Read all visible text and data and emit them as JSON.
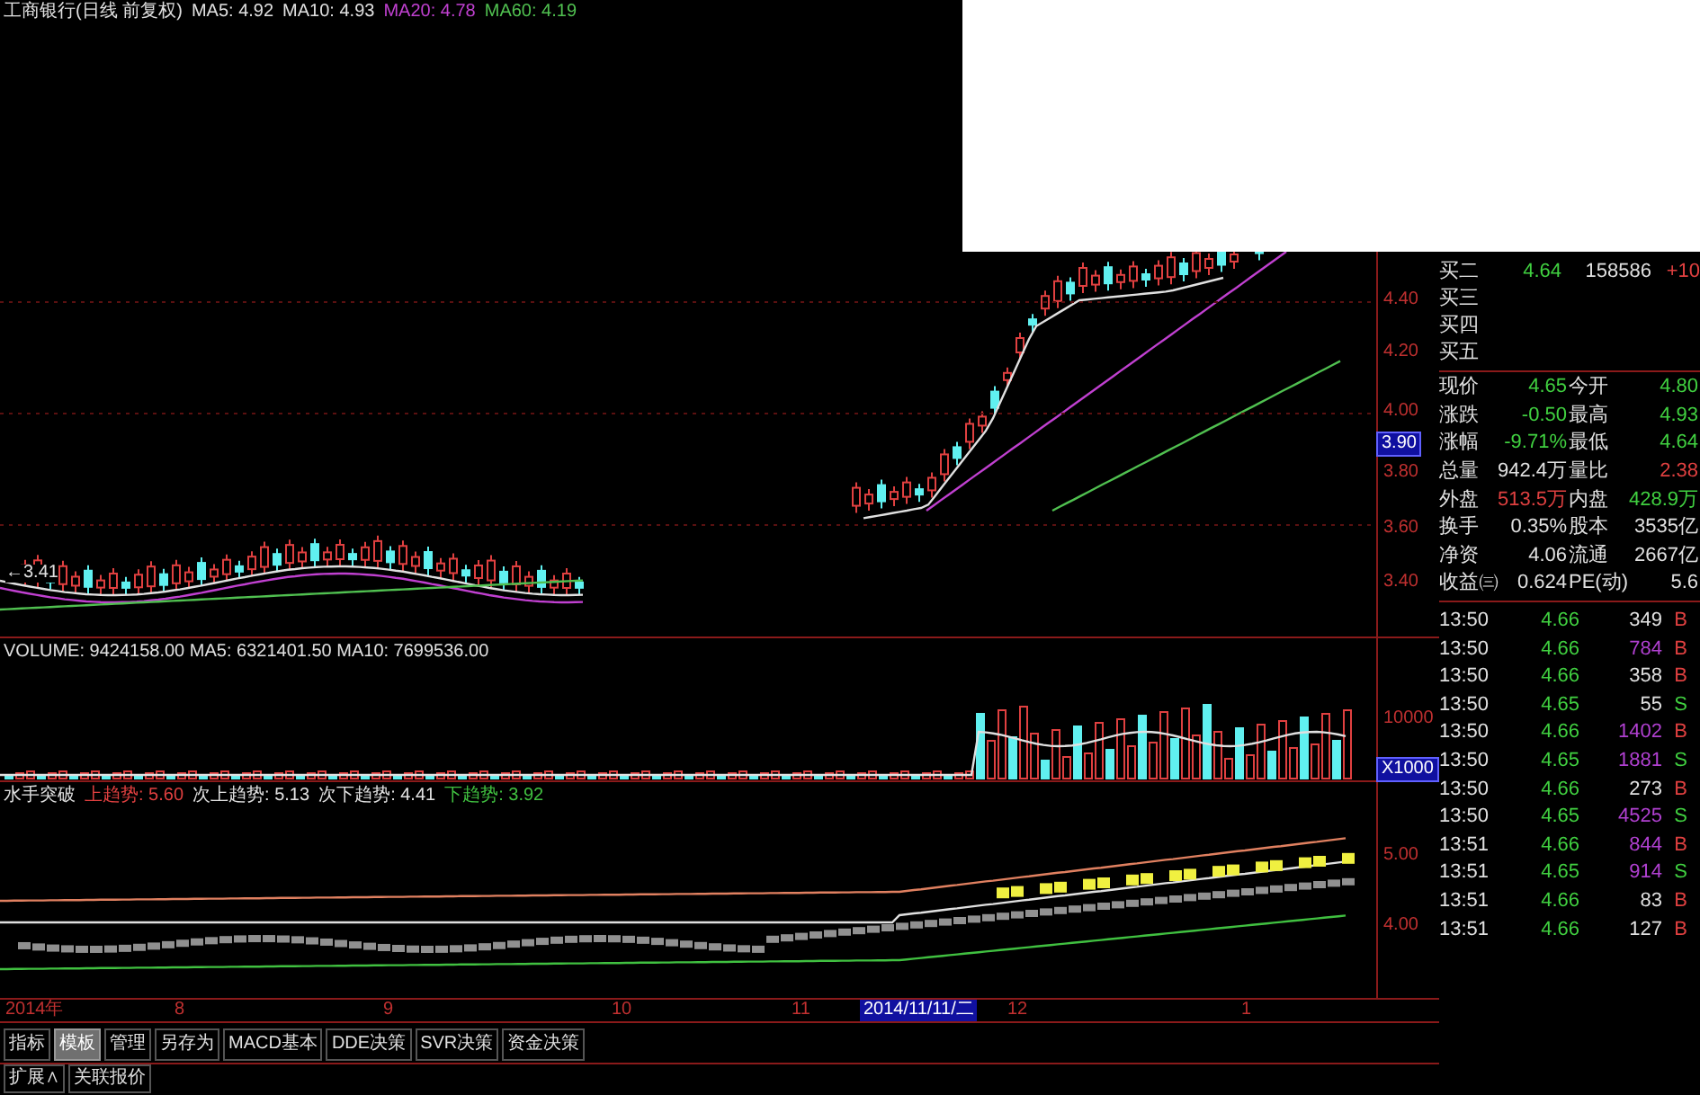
{
  "header": {
    "title": "工商银行(日线 前复权)",
    "averages": [
      {
        "label": "MA5: 4.92",
        "color": "#e0e0e0"
      },
      {
        "label": "MA10: 4.93",
        "color": "#e0e0e0"
      },
      {
        "label": "MA20: 4.78",
        "color": "#c040d0"
      },
      {
        "label": "MA60: 4.19",
        "color": "#50c050"
      }
    ]
  },
  "price_panel": {
    "low_marker": "←3.41",
    "axis": [
      {
        "label": "4.40",
        "kind": "tick"
      },
      {
        "label": "4.20",
        "kind": "tick"
      },
      {
        "label": "4.00",
        "kind": "tick"
      },
      {
        "label": "3.90",
        "kind": "cursor"
      },
      {
        "label": "3.80",
        "kind": "tick"
      },
      {
        "label": "3.60",
        "kind": "tick"
      },
      {
        "label": "3.40",
        "kind": "tick"
      }
    ]
  },
  "volume_panel": {
    "header": "VOLUME: 9424158.00 MA5: 6321401.50 MA10: 7699536.00",
    "axis": [
      {
        "label": "10000",
        "kind": "tick"
      },
      {
        "label": "X1000",
        "kind": "cursor"
      }
    ]
  },
  "indicator_panel": {
    "name": "水手突破",
    "lines": [
      {
        "label": "上趋势: 5.60",
        "color": "#e04040"
      },
      {
        "label": "次上趋势: 5.13",
        "color": "#e0e0e0"
      },
      {
        "label": "次下趋势: 4.41",
        "color": "#e0e0e0"
      },
      {
        "label": "下趋势: 3.92",
        "color": "#40c040"
      }
    ],
    "axis": [
      {
        "label": "5.00",
        "kind": "tick"
      },
      {
        "label": "4.00",
        "kind": "tick"
      }
    ]
  },
  "date_axis": [
    {
      "label": "2014年",
      "kind": "tick"
    },
    {
      "label": "8",
      "kind": "tick"
    },
    {
      "label": "9",
      "kind": "tick"
    },
    {
      "label": "10",
      "kind": "tick"
    },
    {
      "label": "11",
      "kind": "tick"
    },
    {
      "label": "2014/11/11/二",
      "kind": "cursor"
    },
    {
      "label": "12",
      "kind": "tick"
    },
    {
      "label": "1",
      "kind": "tick"
    }
  ],
  "tabs": [
    {
      "label": "指标",
      "selected": false
    },
    {
      "label": "模板",
      "selected": true
    },
    {
      "label": "管理",
      "selected": false
    },
    {
      "label": "另存为",
      "selected": false
    },
    {
      "label": "MACD基本",
      "selected": false
    },
    {
      "label": "DDE决策",
      "selected": false
    },
    {
      "label": "SVR决策",
      "selected": false
    },
    {
      "label": "资金决策",
      "selected": false
    }
  ],
  "bottom_tabs": [
    {
      "label": "扩展∧",
      "selected": false
    },
    {
      "label": "关联报价",
      "selected": false
    }
  ],
  "order_book": [
    {
      "label": "买二",
      "price": "4.64",
      "volume": "158586",
      "change": "+10"
    },
    {
      "label": "买三"
    },
    {
      "label": "买四"
    },
    {
      "label": "买五"
    }
  ],
  "quote": [
    {
      "fields": [
        {
          "label": "现价",
          "value": "4.65",
          "color": "#40d040"
        },
        {
          "label": "今开",
          "value": "4.80",
          "color": "#40d040"
        }
      ]
    },
    {
      "fields": [
        {
          "label": "涨跌",
          "value": "-0.50",
          "color": "#40d040"
        },
        {
          "label": "最高",
          "value": "4.93",
          "color": "#40d040"
        }
      ]
    },
    {
      "fields": [
        {
          "label": "涨幅",
          "value": "-9.71%",
          "color": "#40d040"
        },
        {
          "label": "最低",
          "value": "4.64",
          "color": "#40d040"
        }
      ]
    },
    {
      "fields": [
        {
          "label": "总量",
          "value": "942.4万",
          "color": "#e0e0e0"
        },
        {
          "label": "量比",
          "value": "2.38",
          "color": "#e04040"
        }
      ]
    },
    {
      "fields": [
        {
          "label": "外盘",
          "value": "513.5万",
          "color": "#e04040"
        },
        {
          "label": "内盘",
          "value": "428.9万",
          "color": "#40d040"
        }
      ]
    },
    {
      "fields": [
        {
          "label": "换手",
          "value": "0.35%",
          "color": "#e0e0e0"
        },
        {
          "label": "股本",
          "value": "3535亿",
          "color": "#e0e0e0"
        }
      ]
    },
    {
      "fields": [
        {
          "label": "净资",
          "value": "4.06",
          "color": "#e0e0e0"
        },
        {
          "label": "流通",
          "value": "2667亿",
          "color": "#e0e0e0"
        }
      ]
    },
    {
      "fields": [
        {
          "label": "收益㈢",
          "value": "0.624",
          "color": "#e0e0e0"
        },
        {
          "label": "PE(动)",
          "value": "5.6",
          "color": "#e0e0e0"
        }
      ]
    }
  ],
  "trades": [
    {
      "time": "13:50",
      "price": "4.66",
      "volume": "349",
      "color": "#e0e0e0",
      "side": {
        "label": "B",
        "color": "#e04040"
      }
    },
    {
      "time": "13:50",
      "price": "4.66",
      "volume": "784",
      "color": "#b040d0",
      "side": {
        "label": "B",
        "color": "#e04040"
      }
    },
    {
      "time": "13:50",
      "price": "4.66",
      "volume": "358",
      "color": "#e0e0e0",
      "side": {
        "label": "B",
        "color": "#e04040"
      }
    },
    {
      "time": "13:50",
      "price": "4.65",
      "volume": "55",
      "color": "#e0e0e0",
      "side": {
        "label": "S",
        "color": "#40d040"
      }
    },
    {
      "time": "13:50",
      "price": "4.66",
      "volume": "1402",
      "color": "#b040d0",
      "side": {
        "label": "B",
        "color": "#e04040"
      }
    },
    {
      "time": "13:50",
      "price": "4.65",
      "volume": "1881",
      "color": "#b040d0",
      "side": {
        "label": "S",
        "color": "#40d040"
      }
    },
    {
      "time": "13:50",
      "price": "4.66",
      "volume": "273",
      "color": "#e0e0e0",
      "side": {
        "label": "B",
        "color": "#e04040"
      }
    },
    {
      "time": "13:50",
      "price": "4.65",
      "volume": "4525",
      "color": "#b040d0",
      "side": {
        "label": "S",
        "color": "#40d040"
      }
    },
    {
      "time": "13:51",
      "price": "4.66",
      "volume": "844",
      "color": "#b040d0",
      "side": {
        "label": "B",
        "color": "#e04040"
      }
    },
    {
      "time": "13:51",
      "price": "4.65",
      "volume": "914",
      "color": "#b040d0",
      "side": {
        "label": "S",
        "color": "#40d040"
      }
    },
    {
      "time": "13:51",
      "price": "4.66",
      "volume": "83",
      "color": "#e0e0e0",
      "side": {
        "label": "B",
        "color": "#e04040"
      }
    },
    {
      "time": "13:51",
      "price": "4.66",
      "volume": "127",
      "color": "#e0e0e0",
      "side": {
        "label": "B",
        "color": "#e04040"
      }
    }
  ]
}
